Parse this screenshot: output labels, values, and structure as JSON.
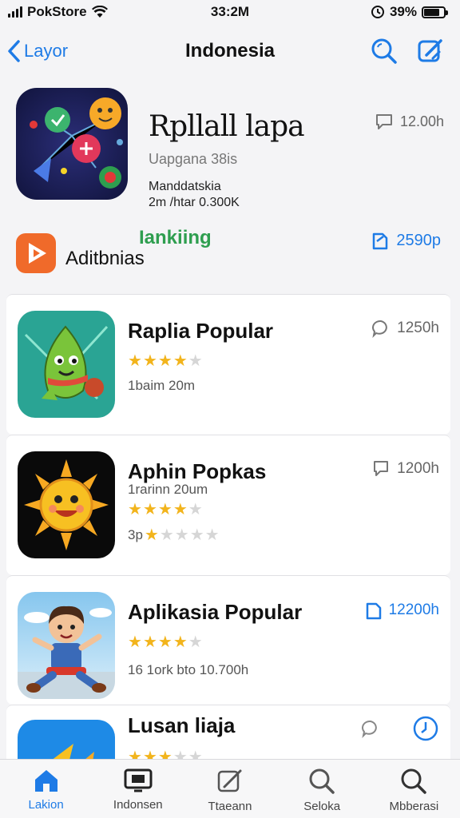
{
  "status_bar": {
    "carrier": "PokStore",
    "time": "33:2M",
    "battery": "39%"
  },
  "nav": {
    "back_label": "Layor",
    "title": "Indonesia"
  },
  "featured": {
    "title": "Rpllall lapa",
    "subtitle": "Uapgana 38is",
    "meta_line1": "Manddatskia",
    "meta_line2": "2m /htar 0.300K",
    "count": "12.00h"
  },
  "section": {
    "label": "Aditbnias",
    "ranking": "Iankiing",
    "action_count": "2590p"
  },
  "apps": [
    {
      "title": "Raplia Popular",
      "rating": 3.5,
      "meta": "1baim 20m",
      "count": "1250h",
      "count_style": "gray"
    },
    {
      "title": "Aphin Popkas",
      "rating": 4,
      "meta": "1rarinn 20um",
      "meta2": "3p",
      "rating2": 1,
      "count": "1200h",
      "count_style": "gray"
    },
    {
      "title": "Aplikasia Popular",
      "rating": 4,
      "meta": "16 1ork bto 10.700h",
      "count": "12200h",
      "count_style": "blue"
    },
    {
      "title": "Lusan liaja",
      "rating": 3,
      "meta": "",
      "count": "",
      "count_style": "gray"
    }
  ],
  "tabs": [
    {
      "label": "Lakion",
      "icon": "app-store-icon",
      "active": true
    },
    {
      "label": "Indonsen",
      "icon": "games-icon",
      "active": false
    },
    {
      "label": "Ttaeann",
      "icon": "arcade-icon",
      "active": false
    },
    {
      "label": "Seloka",
      "icon": "search-icon",
      "active": false
    },
    {
      "label": "Mbberasi",
      "icon": "search-icon",
      "active": false
    }
  ],
  "colors": {
    "accent": "#1e7be6",
    "star": "#f2b41c",
    "ranking": "#2e9e4f"
  }
}
